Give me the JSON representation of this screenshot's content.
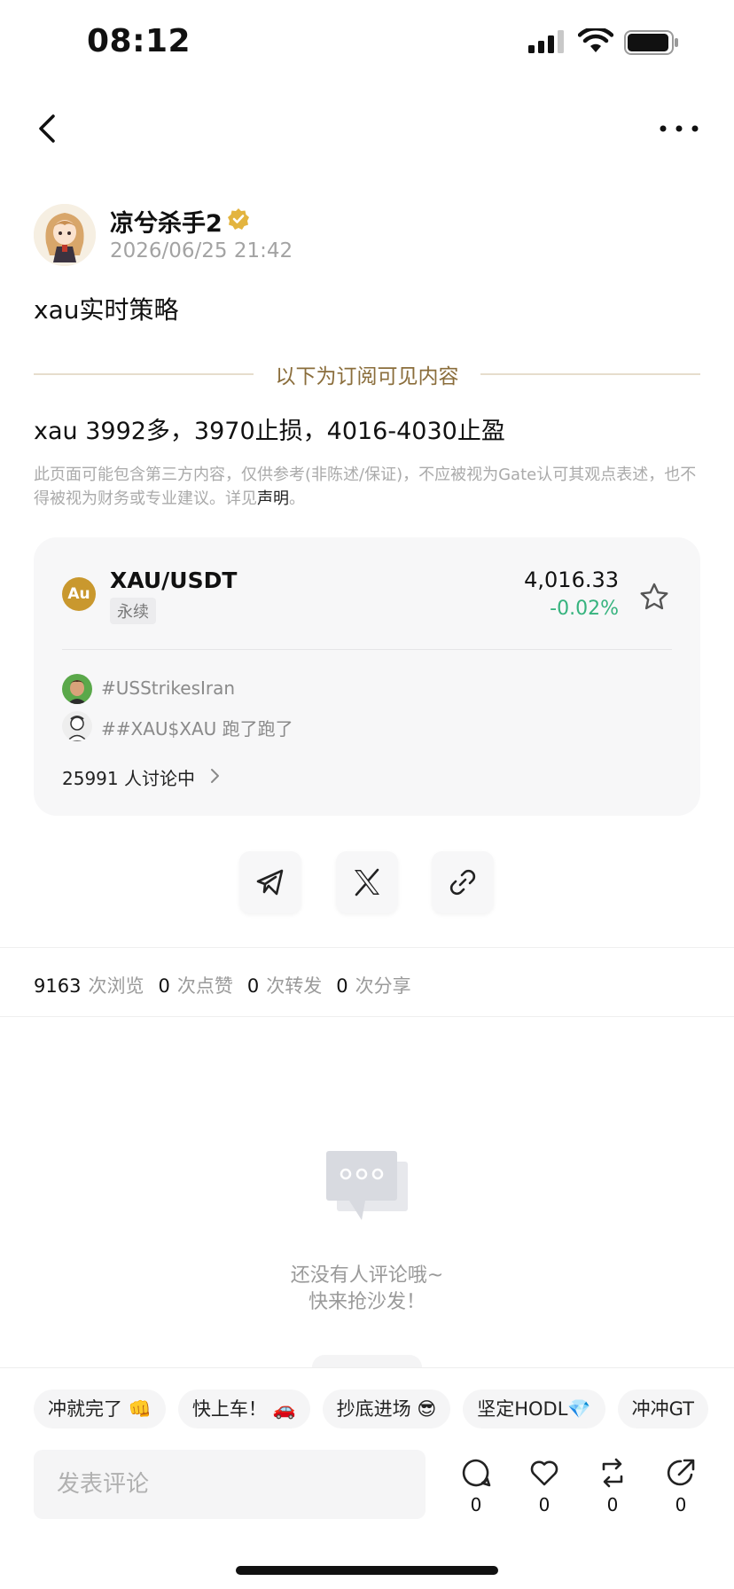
{
  "status_bar": {
    "time": "08:12"
  },
  "author": {
    "name": "凉兮杀手2",
    "time": "2026/06/25 21:42"
  },
  "post": {
    "title": "xau实时策略",
    "subscriber_divider": "以下为订阅可见内容",
    "body": "xau 3992多，3970止损，4016-4030止盈",
    "disclaimer": "此页面可能包含第三方内容，仅供参考(非陈述/保证)，不应被视为Gate认可其观点表述，也不得被视为财务或专业建议。详见",
    "disclaimer_link": "声明",
    "disclaimer_end": "。"
  },
  "market_card": {
    "coin_symbol": "Au",
    "pair": "XAU/USDT",
    "tag": "永续",
    "price": "4,016.33",
    "change": "-0.02%",
    "change_color": "#36b37e",
    "topics": [
      {
        "text": "#USStrikesIran"
      },
      {
        "text": "##XAU$XAU 跑了跑了"
      }
    ],
    "discussion": "25991 人讨论中"
  },
  "share": {
    "buttons": [
      {
        "icon": "telegram-icon"
      },
      {
        "icon": "x-icon"
      },
      {
        "icon": "link-icon"
      }
    ]
  },
  "stats": {
    "views": "9163",
    "views_label": "次浏览",
    "likes": "0",
    "likes_label": "次点赞",
    "reposts": "0",
    "reposts_label": "次转发",
    "shares": "0",
    "shares_label": "次分享"
  },
  "empty_state": {
    "line1": "还没有人评论哦~",
    "line2": "快来抢沙发！"
  },
  "quick_replies": [
    "冲就完了 👊",
    "快上车！ 🚗",
    "抄底进场 😎",
    "坚定HODL💎",
    "冲冲GT"
  ],
  "comment_bar": {
    "placeholder": "发表评论",
    "comment_count": "0",
    "like_count": "0",
    "repost_count": "0",
    "share_count": "0"
  }
}
